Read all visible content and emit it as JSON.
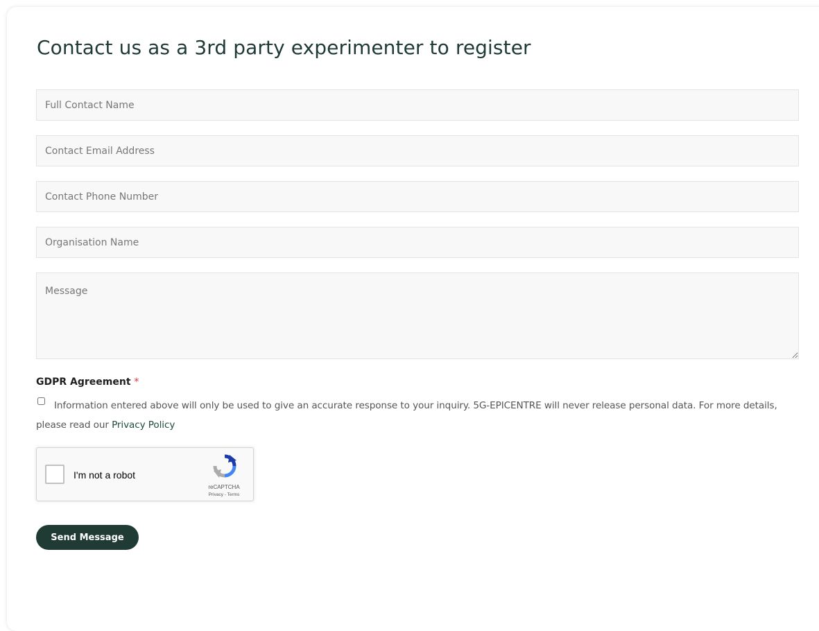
{
  "form": {
    "title": "Contact us as a 3rd party experimenter to register",
    "fields": {
      "full_name": {
        "placeholder": "Full Contact Name",
        "value": ""
      },
      "email": {
        "placeholder": "Contact Email Address",
        "value": ""
      },
      "phone": {
        "placeholder": "Contact Phone Number",
        "value": ""
      },
      "organisation": {
        "placeholder": "Organisation Name",
        "value": ""
      },
      "message": {
        "placeholder": "Message",
        "value": ""
      }
    },
    "gdpr": {
      "label": "GDPR Agreement",
      "required_marker": "*",
      "checked": false,
      "text": "Information entered above will only be used to give an accurate response to your inquiry. 5G-EPICENTRE will never release personal data. For more details, please read our",
      "link_text": "Privacy Policy"
    },
    "recaptcha": {
      "label": "I'm not a robot",
      "brand": "reCAPTCHA",
      "links": "Privacy - Terms",
      "icon": "recaptcha-logo"
    },
    "submit_label": "Send Message"
  },
  "colors": {
    "accent": "#203a34",
    "title": "#1f3a36",
    "link": "#1f4a3e",
    "required": "#d63637",
    "field_bg": "#f8f8f8"
  }
}
